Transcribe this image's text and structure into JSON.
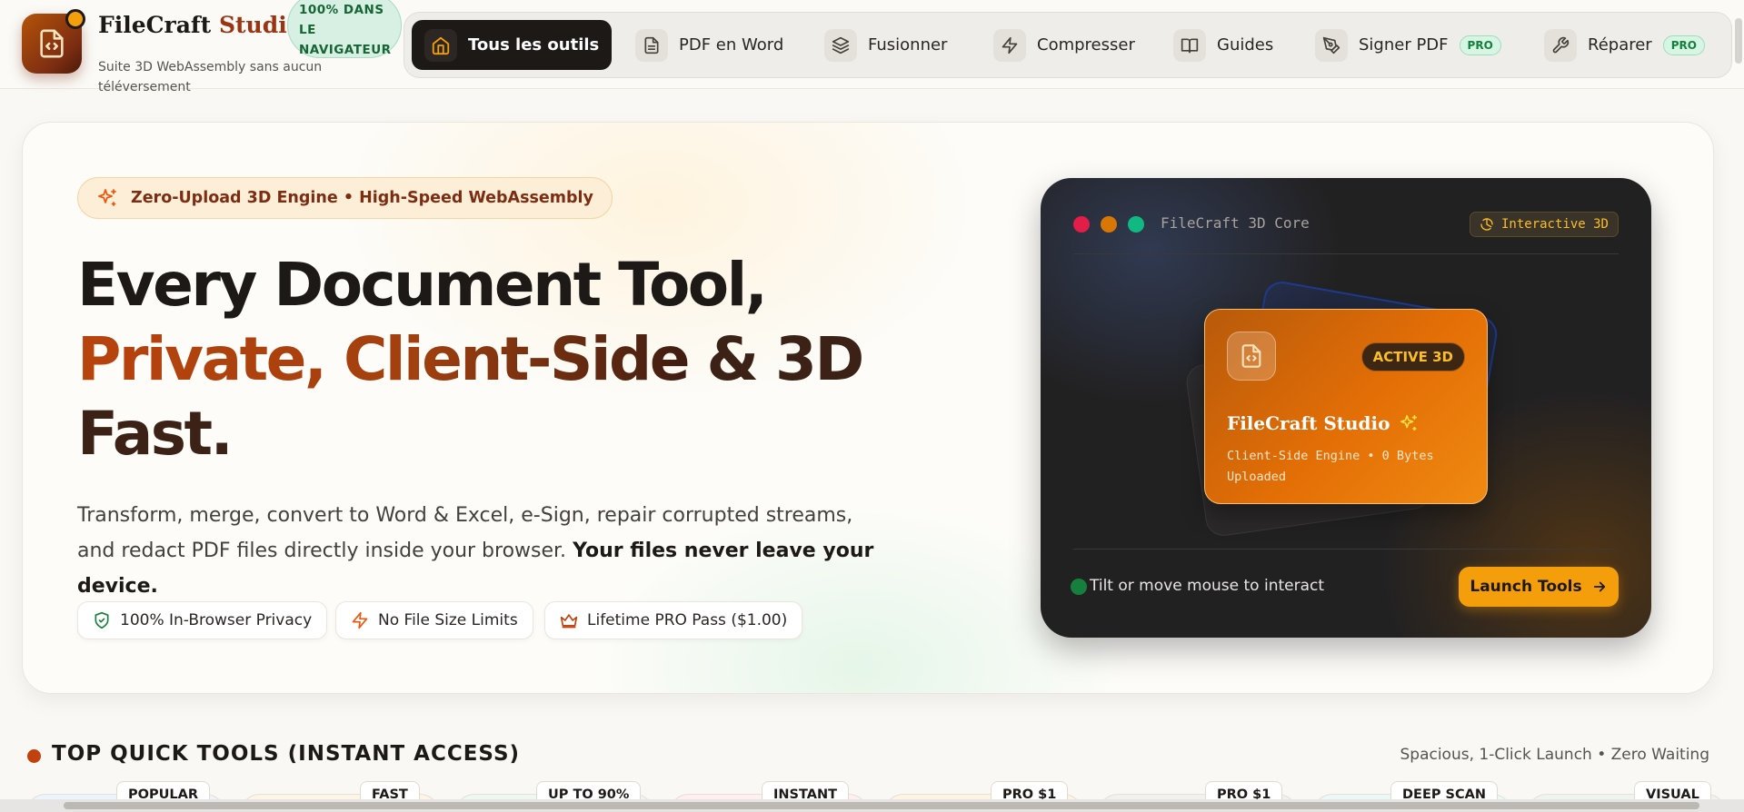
{
  "brand": {
    "name_main": "FileCraft ",
    "name_accent": "Studio",
    "subtitle": "Suite 3D WebAssembly sans aucun téléversement",
    "browser_badge": "100% DANS LE NAVIGATEUR"
  },
  "nav": {
    "items": [
      {
        "label": "Tous les outils",
        "icon": "home-icon",
        "active": true
      },
      {
        "label": "PDF en Word",
        "icon": "document-icon"
      },
      {
        "label": "Fusionner",
        "icon": "layers-icon"
      },
      {
        "label": "Compresser",
        "icon": "lightning-icon"
      },
      {
        "label": "Guides",
        "icon": "book-icon"
      },
      {
        "label": "Signer PDF",
        "icon": "pen-icon",
        "tag": "PRO"
      },
      {
        "label": "Réparer",
        "icon": "wrench-icon",
        "tag": "PRO"
      }
    ]
  },
  "hero": {
    "badge": "Zero-Upload 3D Engine • High-Speed WebAssembly",
    "title_line1": "Every Document Tool,",
    "title_line2a": "Private, Client-Side",
    "title_line2b": " & 3D",
    "title_line3": "Fast.",
    "description": "Transform, merge, convert to Word & Excel, e-Sign, repair corrupted streams, and redact PDF files directly inside your browser. ",
    "description_bold": "Your files never leave your device.",
    "chips": [
      {
        "label": "100% In-Browser Privacy",
        "icon": "shield-check-icon"
      },
      {
        "label": "No File Size Limits",
        "icon": "lightning-icon"
      },
      {
        "label": "Lifetime PRO Pass ($1.00)",
        "icon": "crown-icon"
      }
    ]
  },
  "demo": {
    "window_title": "FileCraft 3D Core",
    "interactive_badge": "Interactive 3D",
    "card_badge": "ACTIVE 3D",
    "card_name": "FileCraft Studio",
    "card_subtitle": "Client-Side Engine • 0 Bytes Uploaded",
    "hint": "Tilt or move mouse to interact",
    "launch_label": "Launch Tools"
  },
  "quick_tools": {
    "title": "TOP QUICK TOOLS (INSTANT ACCESS)",
    "subtitle": "Spacious, 1-Click Launch • Zero Waiting",
    "tags": [
      "POPULAR",
      "FAST",
      "UP TO 90%",
      "INSTANT",
      "PRO $1",
      "PRO $1",
      "DEEP SCAN",
      "VISUAL"
    ]
  },
  "colors": {
    "accent": "#c2410c",
    "brand_dark": "#1c1917",
    "amber": "#f59e0b",
    "pro_green": "#15803d"
  }
}
